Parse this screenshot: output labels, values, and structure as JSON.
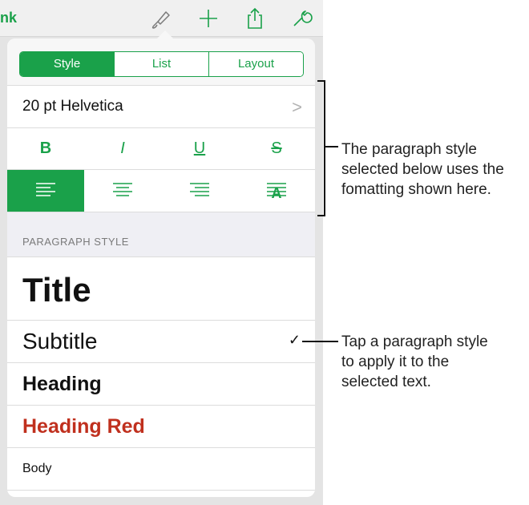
{
  "toolbar": {
    "app_name": "nk",
    "icons": [
      "paintbrush-icon",
      "plus-icon",
      "share-icon",
      "wrench-icon"
    ]
  },
  "popover": {
    "tabs": [
      {
        "label": "Style",
        "active": true
      },
      {
        "label": "List",
        "active": false
      },
      {
        "label": "Layout",
        "active": false
      }
    ],
    "font": {
      "label": "20 pt Helvetica",
      "chevron": ">"
    },
    "format_buttons": [
      {
        "label": "B",
        "name": "bold"
      },
      {
        "label": "I",
        "name": "italic"
      },
      {
        "label": "U",
        "name": "underline"
      },
      {
        "label": "S",
        "name": "strikethrough"
      }
    ],
    "alignment": {
      "options": [
        "left-align-icon",
        "center-align-icon",
        "right-align-icon",
        "justify-align-icon"
      ],
      "selected": "left"
    },
    "paragraph_section": {
      "header": "PARAGRAPH STYLE",
      "items": [
        {
          "label": "Title",
          "checked": false
        },
        {
          "label": "Subtitle",
          "checked": true
        },
        {
          "label": "Heading",
          "checked": false
        },
        {
          "label": "Heading Red",
          "checked": false
        },
        {
          "label": "Body",
          "checked": false
        }
      ],
      "checkmark": "✓"
    }
  },
  "callouts": {
    "format_note": [
      "The paragraph style",
      "selected below uses the",
      "fomatting shown here."
    ],
    "style_note": [
      "Tap a paragraph style",
      "to apply it to the",
      "selected text."
    ]
  },
  "colors": {
    "accent": "#1aa14a",
    "heading_red": "#c0301e"
  }
}
